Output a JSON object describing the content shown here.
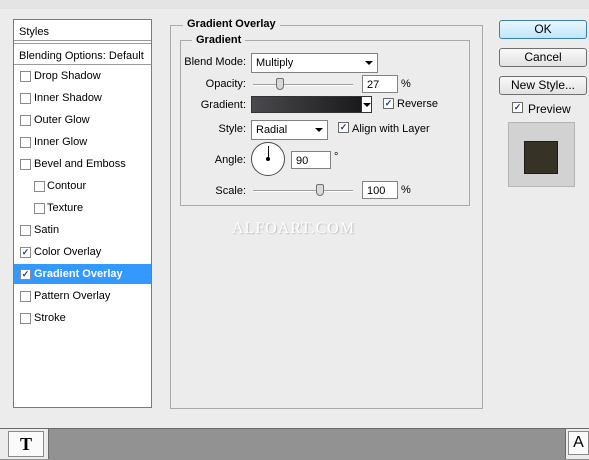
{
  "styles_panel": {
    "header": "Styles",
    "blending_options": "Blending Options: Default",
    "items": [
      {
        "label": "Drop Shadow",
        "checked": false,
        "indent": false,
        "selected": false
      },
      {
        "label": "Inner Shadow",
        "checked": false,
        "indent": false,
        "selected": false
      },
      {
        "label": "Outer Glow",
        "checked": false,
        "indent": false,
        "selected": false
      },
      {
        "label": "Inner Glow",
        "checked": false,
        "indent": false,
        "selected": false
      },
      {
        "label": "Bevel and Emboss",
        "checked": false,
        "indent": false,
        "selected": false
      },
      {
        "label": "Contour",
        "checked": false,
        "indent": true,
        "selected": false
      },
      {
        "label": "Texture",
        "checked": false,
        "indent": true,
        "selected": false
      },
      {
        "label": "Satin",
        "checked": false,
        "indent": false,
        "selected": false
      },
      {
        "label": "Color Overlay",
        "checked": true,
        "indent": false,
        "selected": false
      },
      {
        "label": "Gradient Overlay",
        "checked": true,
        "indent": false,
        "selected": true
      },
      {
        "label": "Pattern Overlay",
        "checked": false,
        "indent": false,
        "selected": false
      },
      {
        "label": "Stroke",
        "checked": false,
        "indent": false,
        "selected": false
      }
    ]
  },
  "gradient_overlay": {
    "title": "Gradient Overlay",
    "section_title": "Gradient",
    "blend_mode_label": "Blend Mode:",
    "blend_mode_value": "Multiply",
    "opacity_label": "Opacity:",
    "opacity_value": "27",
    "opacity_fraction": 0.27,
    "percent": "%",
    "gradient_label": "Gradient:",
    "reverse_label": "Reverse",
    "reverse_checked": true,
    "style_label": "Style:",
    "style_value": "Radial",
    "align_label": "Align with Layer",
    "align_checked": true,
    "angle_label": "Angle:",
    "angle_value": "90",
    "degree_symbol": "°",
    "scale_label": "Scale:",
    "scale_value": "100",
    "scale_fraction": 0.67,
    "gradient_colors": [
      "#4a4a4e",
      "#1a1a1c"
    ]
  },
  "watermark": "ALFOART.COM",
  "buttons": {
    "ok": "OK",
    "cancel": "Cancel",
    "new_style": "New Style...",
    "preview_label": "Preview",
    "preview_checked": true
  },
  "preview_color": "#363326",
  "toolbar": {
    "left_tool_glyph": "T",
    "right_tool_glyph": "A"
  }
}
